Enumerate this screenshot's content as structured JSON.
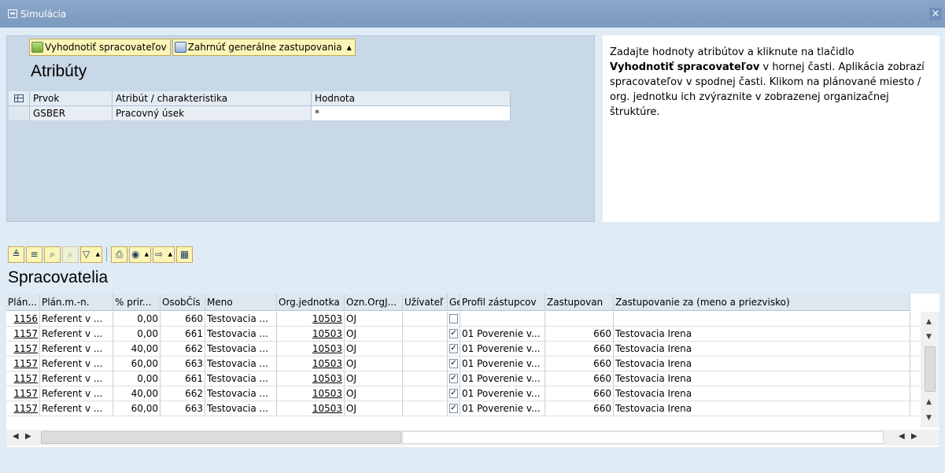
{
  "window": {
    "title": "Simulácia",
    "close_label": "×"
  },
  "attr_panel": {
    "buttons": [
      {
        "label": "Vyhodnotiť spracovateľov",
        "icon": "evaluate-icon"
      },
      {
        "label": "Zahrnúť generálne zastupovania",
        "icon": "include-icon"
      }
    ],
    "title": "Atribúty",
    "columns": [
      "Prvok",
      "Atribút / charakteristika",
      "Hodnota"
    ],
    "rows": [
      {
        "prvok": "GSBER",
        "atribut": "Pracovný úsek",
        "hodnota": "*"
      }
    ]
  },
  "help": {
    "line1": "Zadajte hodnoty atribútov a kliknute na tlačidlo",
    "bold": "Vyhodnotiť spracovateľov",
    "line2_rest": " v hornej časti. Aplikácia zobrazí spracovateľov v spodnej časti. Klikom na plánované miesto / org. jednotku ich zvýraznite v zobrazenej organizačnej štruktúre."
  },
  "toolbar_icons": [
    "sort-ascending-icon",
    "sort-descending-icon",
    "find-icon",
    "find-next-icon",
    "filter-icon",
    "print-icon",
    "view-icon",
    "export-icon",
    "layout-icon"
  ],
  "results": {
    "title": "Spracovatelia",
    "columns": [
      "Plán...",
      "Plán.m.-n.",
      "% prir...",
      "OsobČís",
      "Meno",
      "Org.jednotka",
      "Ozn.OrgJ...",
      "Užívateľ",
      "Ge",
      "Profil zástupcov",
      "Zastupovan",
      "Zastupovanie za (meno a priezvisko)"
    ],
    "rows": [
      {
        "plan": "1156",
        "plan_n": "Referent v ...",
        "pct": "0,00",
        "osob": "660",
        "meno": "Testovacia ...",
        "org": "10503",
        "ozn": "OJ",
        "user": "",
        "ge": false,
        "profil": "",
        "zast": "",
        "zast_meno": ""
      },
      {
        "plan": "1157",
        "plan_n": "Referent v ...",
        "pct": "0,00",
        "osob": "661",
        "meno": "Testovacia ...",
        "org": "10503",
        "ozn": "OJ",
        "user": "",
        "ge": true,
        "profil": "01 Poverenie v...",
        "zast": "660",
        "zast_meno": "Testovacia Irena"
      },
      {
        "plan": "1157",
        "plan_n": "Referent v ...",
        "pct": "40,00",
        "osob": "662",
        "meno": "Testovacia ...",
        "org": "10503",
        "ozn": "OJ",
        "user": "",
        "ge": true,
        "profil": "01 Poverenie v...",
        "zast": "660",
        "zast_meno": "Testovacia Irena"
      },
      {
        "plan": "1157",
        "plan_n": "Referent v ...",
        "pct": "60,00",
        "osob": "663",
        "meno": "Testovacia ...",
        "org": "10503",
        "ozn": "OJ",
        "user": "",
        "ge": true,
        "profil": "01 Poverenie v...",
        "zast": "660",
        "zast_meno": "Testovacia Irena"
      },
      {
        "plan": "1157",
        "plan_n": "Referent v ...",
        "pct": "0,00",
        "osob": "661",
        "meno": "Testovacia ...",
        "org": "10503",
        "ozn": "OJ",
        "user": "",
        "ge": true,
        "profil": "01 Poverenie v...",
        "zast": "660",
        "zast_meno": "Testovacia Irena"
      },
      {
        "plan": "1157",
        "plan_n": "Referent v ...",
        "pct": "40,00",
        "osob": "662",
        "meno": "Testovacia ...",
        "org": "10503",
        "ozn": "OJ",
        "user": "",
        "ge": true,
        "profil": "01 Poverenie v...",
        "zast": "660",
        "zast_meno": "Testovacia Irena"
      },
      {
        "plan": "1157",
        "plan_n": "Referent v ...",
        "pct": "60,00",
        "osob": "663",
        "meno": "Testovacia ...",
        "org": "10503",
        "ozn": "OJ",
        "user": "",
        "ge": true,
        "profil": "01 Poverenie v...",
        "zast": "660",
        "zast_meno": "Testovacia Irena"
      }
    ],
    "check_glyph": "✓"
  },
  "colors": {
    "background": "#dfebf5",
    "titlebar": "#8ba6c8",
    "button_fill": "#fbf5b7"
  }
}
